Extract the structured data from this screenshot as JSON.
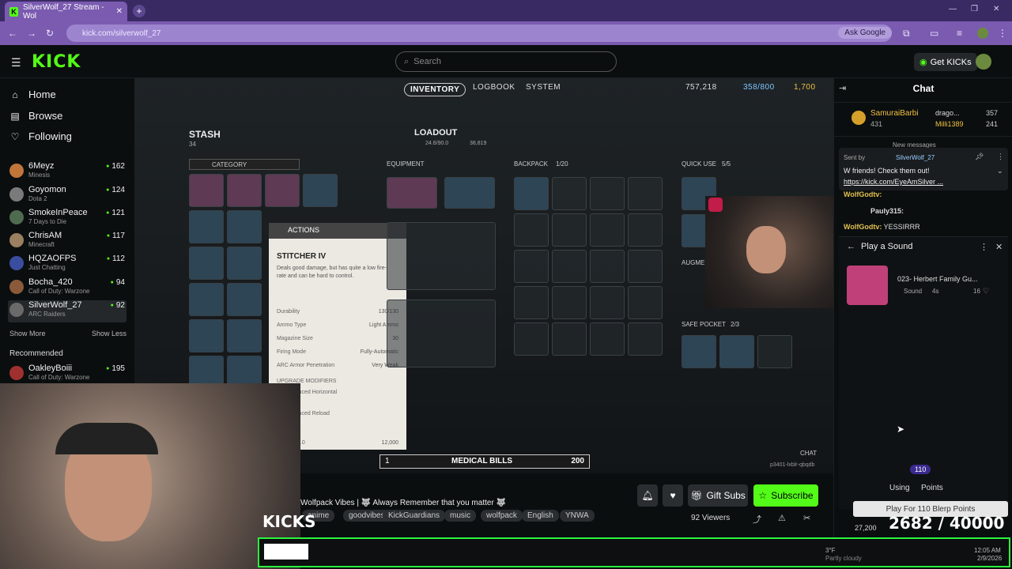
{
  "browser": {
    "tab_title": "SilverWolf_27 Stream - Wol",
    "url": "kick.com/silverwolf_27",
    "ask_google": "Ask Google"
  },
  "kick": {
    "logo": "KICK",
    "search_placeholder": "Search",
    "get_kicks": "Get KICKs"
  },
  "sidebar": {
    "nav": [
      {
        "label": "Home",
        "icon": "home-icon"
      },
      {
        "label": "Browse",
        "icon": "browse-icon"
      },
      {
        "label": "Following",
        "icon": "heart-icon"
      }
    ],
    "following": [
      {
        "name": "6Meyz",
        "game": "Minesis",
        "viewers": "162",
        "color": "#c0763a"
      },
      {
        "name": "Goyomon",
        "game": "Dota 2",
        "viewers": "124",
        "color": "#7a7a7a"
      },
      {
        "name": "SmokeInPeace",
        "game": "7 Days to Die",
        "viewers": "121",
        "color": "#4f6b4f"
      },
      {
        "name": "ChrisAM",
        "game": "Minecraft",
        "viewers": "117",
        "color": "#9a8060"
      },
      {
        "name": "HQZAOFPS",
        "game": "Just Chatting",
        "viewers": "112",
        "color": "#3a4ea0"
      },
      {
        "name": "Bocha_420",
        "game": "Call of Duty: Warzone",
        "viewers": "94",
        "color": "#8a5a3a"
      },
      {
        "name": "SilverWolf_27",
        "game": "ARC Raiders",
        "viewers": "92",
        "color": "#6a6a6a"
      }
    ],
    "show_more": "Show More",
    "show_less": "Show Less",
    "recommended_label": "Recommended",
    "recommended": [
      {
        "name": "OakleyBoiii",
        "game": "Call of Duty: Warzone",
        "viewers": "195",
        "color": "#a03030"
      }
    ]
  },
  "game": {
    "tabs": [
      "INVENTORY",
      "LOGBOOK",
      "SYSTEM"
    ],
    "currency1": "757,218",
    "currency2": "358/800",
    "currency3": "1,700",
    "stash_label": "STASH",
    "stash_count": "34",
    "category_label": "CATEGORY",
    "loadout_label": "LOADOUT",
    "loadout_weight": "24.6/90.0",
    "loadout_value": "38,819",
    "equipment_label": "EQUIPMENT",
    "backpack_label": "BACKPACK",
    "backpack_count": "1/20",
    "quickuse_label": "QUICK USE",
    "quickuse_count": "5/5",
    "safepocket_label": "SAFE POCKET",
    "safepocket_count": "2/3",
    "augment_label": "AUGME",
    "tooltip": {
      "actions": "ACTIONS",
      "name": "STITCHER IV",
      "desc": "Deals good damage, but has quite a low fire-rate and can be hard to control.",
      "stats": [
        {
          "label": "Durability",
          "value": "130/130"
        },
        {
          "label": "Ammo Type",
          "value": "Light Ammo"
        },
        {
          "label": "Magazine Size",
          "value": "30"
        },
        {
          "label": "Firing Mode",
          "value": "Fully-Automatic"
        },
        {
          "label": "ARC Armor Penetration",
          "value": "Very Weak"
        }
      ],
      "modifiers": "UPGRADE MODIFIERS",
      "mod1": "luced Horizontal",
      "mod2": "luced Reload",
      "weight": "6.0",
      "price": "12,000"
    },
    "medical_bills_qty": "1",
    "medical_bills": "MEDICAL BILLS",
    "medical_bills_value": "200",
    "chat_label": "CHAT",
    "player_tag": "p3401-lxblr-qbqdb"
  },
  "stream": {
    "title": "Wolfpack Vibes | 🐺 Always Remember that you matter 🐺",
    "tags": [
      "anime",
      "goodvibes",
      "KickGuardians",
      "music",
      "wolfpack",
      "English",
      "YNWA"
    ],
    "viewers": "92 Viewers",
    "gift_subs": "Gift Subs",
    "subscribe": "Subscribe"
  },
  "chat": {
    "title": "Chat",
    "top": [
      {
        "name": "SamuraiBarbi",
        "value": "431"
      },
      {
        "name": "drago...",
        "value": "357"
      },
      {
        "name": "Milli1389",
        "value": "241"
      }
    ],
    "new_messages": "New messages",
    "pinned_by": "Sent by",
    "pinned_user": "SilverWolf_27",
    "pinned_text": "W friends! Check them out!",
    "pinned_link": "https://kick.com/EyeAmSilver ...",
    "messages": [
      {
        "name": "WolfGodtv:",
        "text": ""
      },
      {
        "name": "Pauly315:",
        "text": ""
      },
      {
        "name": "WolfGodtv:",
        "text": "YESSIRRR"
      }
    ],
    "sound_title": "Play a Sound",
    "sound_name": "023- Herbert Family Gu...",
    "sound_type": "Sound",
    "sound_len": "4s",
    "sound_likes": "16",
    "points": "110",
    "using": "Using",
    "points_label": "Points",
    "play_button": "Play For 110 Blerp Points",
    "points_total": "27,200"
  },
  "overlay": {
    "kicks": "KICKS",
    "goal": "2682 / 40000",
    "temp": "3°F",
    "weather": "Partly cloudy",
    "time": "12:05 AM",
    "date": "2/9/2026"
  }
}
